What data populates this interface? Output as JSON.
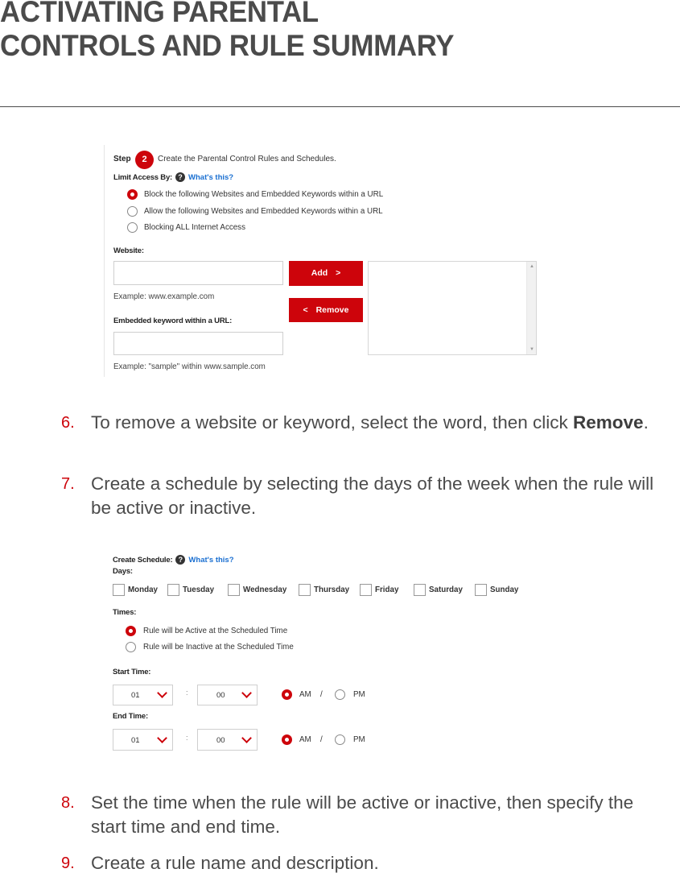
{
  "header": {
    "title_line1": "ACTIVATING PARENTAL",
    "title_line2": "CONTROLS AND RULE SUMMARY"
  },
  "screenshot1": {
    "step_label": "Step",
    "step_number": "2",
    "step_text": "Create the Parental Control Rules and Schedules.",
    "limit_access_label": "Limit Access By:",
    "help_icon_glyph": "?",
    "whats_this": "What's this?",
    "limit_options": [
      {
        "label": "Block the following Websites and Embedded Keywords within a URL",
        "selected": true
      },
      {
        "label": "Allow the following Websites and Embedded Keywords within a URL",
        "selected": false
      },
      {
        "label": "Blocking ALL Internet Access",
        "selected": false
      }
    ],
    "website_label": "Website:",
    "website_value": "",
    "website_example": "Example: www.example.com",
    "keyword_label": "Embedded keyword within a URL:",
    "keyword_value": "",
    "keyword_example": "Example: \"sample\" within www.sample.com",
    "add_button": "Add",
    "add_icon": ">",
    "remove_button": "Remove",
    "remove_icon": "<",
    "scroll_up_icon": "▲",
    "scroll_down_icon": "▼"
  },
  "steps_a": [
    {
      "num": "6.",
      "text_before": "To remove a website or keyword, select the word, then click ",
      "bold": "Remove",
      "text_after": "."
    },
    {
      "num": "7.",
      "text": "Create a schedule by selecting the days of the week when the rule will be active or inactive."
    }
  ],
  "screenshot2": {
    "create_schedule_label": "Create Schedule:",
    "help_icon_glyph": "?",
    "whats_this": "What's this?",
    "days_label": "Days:",
    "days": [
      {
        "label": "Monday",
        "checked": false
      },
      {
        "label": "Tuesday",
        "checked": false
      },
      {
        "label": "Wednesday",
        "checked": false
      },
      {
        "label": "Thursday",
        "checked": false
      },
      {
        "label": "Friday",
        "checked": false
      },
      {
        "label": "Saturday",
        "checked": false
      },
      {
        "label": "Sunday",
        "checked": false
      }
    ],
    "times_label": "Times:",
    "time_options": [
      {
        "label": "Rule will be Active at the Scheduled Time",
        "selected": true
      },
      {
        "label": "Rule will be Inactive at the Scheduled Time",
        "selected": false
      }
    ],
    "start_time_label": "Start Time:",
    "start_hour": "01",
    "start_minute": "00",
    "start_period": "AM",
    "end_time_label": "End Time:",
    "end_hour": "01",
    "end_minute": "00",
    "end_period": "AM",
    "colon": ":",
    "am_label": "AM",
    "slash": "/",
    "pm_label": "PM"
  },
  "steps_b": [
    {
      "num": "8.",
      "text": "Set the time when the rule will be active or inactive, then specify the start time and end time."
    },
    {
      "num": "9.",
      "text": "Create a rule name and description."
    }
  ],
  "colors": {
    "accent_red": "#cd040b",
    "link_blue": "#1a6fd1",
    "heading_gray": "#4b4b4b"
  }
}
